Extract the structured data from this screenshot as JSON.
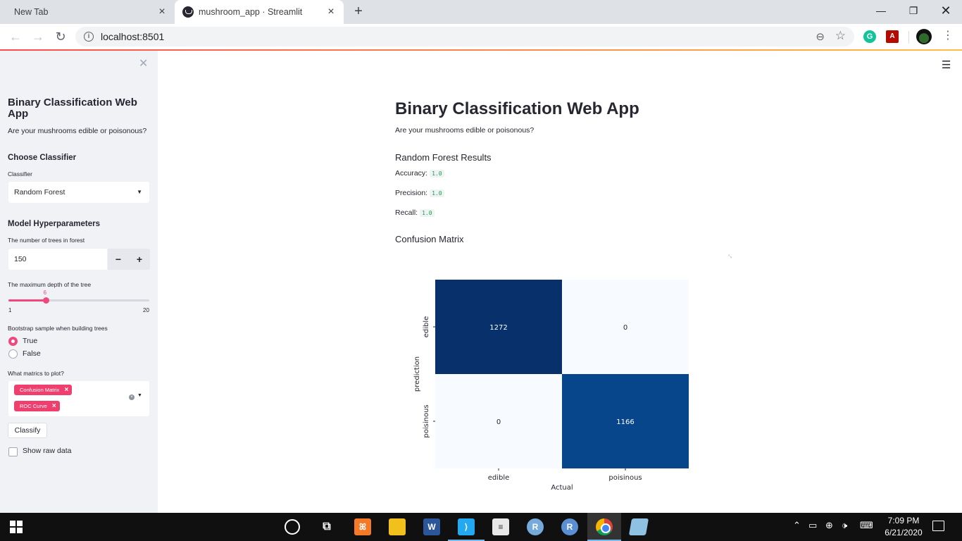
{
  "browser": {
    "tabs": [
      {
        "title": "New Tab"
      },
      {
        "title": "mushroom_app · Streamlit"
      }
    ],
    "new_tab_symbol": "+",
    "url": "localhost:8501",
    "icons": [
      "back-arrow-icon",
      "forward-arrow-icon",
      "reload-icon",
      "info-icon",
      "zoom-out-icon",
      "star-icon",
      "grammarly-icon",
      "acrobat-pdf-icon",
      "profile-avatar",
      "menu-dots-icon"
    ]
  },
  "sidebar": {
    "title": "Binary Classification Web App",
    "subtitle": "Are your mushrooms edible or poisonous?",
    "choose_header": "Choose Classifier",
    "classifier_label": "Classifier",
    "classifier_value": "Random Forest",
    "hyper_header": "Model Hyperparameters",
    "trees_label": "The number of trees in forest",
    "trees_value": "150",
    "minus": "−",
    "plus": "+",
    "depth_label": "The maximum depth of the tree",
    "depth_value": "6",
    "depth_value_num": 6,
    "depth_min": "1",
    "depth_max": "20",
    "depth_min_num": 1,
    "depth_max_num": 20,
    "bootstrap_label": "Bootstrap sample when building trees",
    "bootstrap_options": [
      "True",
      "False"
    ],
    "bootstrap_selected": "True",
    "metrics_label": "What matrics to plot?",
    "metrics_selected": [
      "Confusion Matrix",
      "ROC Curve"
    ],
    "classify_button": "Classify",
    "show_raw_label": "Show raw data",
    "show_raw_checked": false
  },
  "main": {
    "title": "Binary Classification Web App",
    "subtitle": "Are your mushrooms edible or poisonous?",
    "results_header": "Random Forest Results",
    "accuracy_label": "Accuracy:",
    "accuracy_value": "1.0",
    "precision_label": "Precision:",
    "precision_value": "1.0",
    "recall_label": "Recall:",
    "recall_value": "1.0",
    "cm_header": "Confusion Matrix"
  },
  "chart_data": {
    "type": "heatmap",
    "title": "",
    "xlabel": "Actual",
    "ylabel": "prediction",
    "x_categories": [
      "edible",
      "poisinous"
    ],
    "y_categories": [
      "edible",
      "poisinous"
    ],
    "values": [
      [
        1272,
        0
      ],
      [
        0,
        1166
      ]
    ],
    "colormap": "Blues",
    "colors": {
      "high": "#08306b",
      "mid": "#08468c",
      "low": "#f7fbff"
    }
  },
  "taskbar": {
    "time": "7:09 PM",
    "date": "6/21/2020",
    "apps": [
      "start-icon",
      "cortana-icon",
      "task-view-icon",
      "xampp-icon",
      "file-explorer-icon",
      "word-icon",
      "vscode-icon",
      "document-icon",
      "rstudio-icon",
      "r-icon",
      "chrome-icon",
      "other-app-icon"
    ]
  }
}
